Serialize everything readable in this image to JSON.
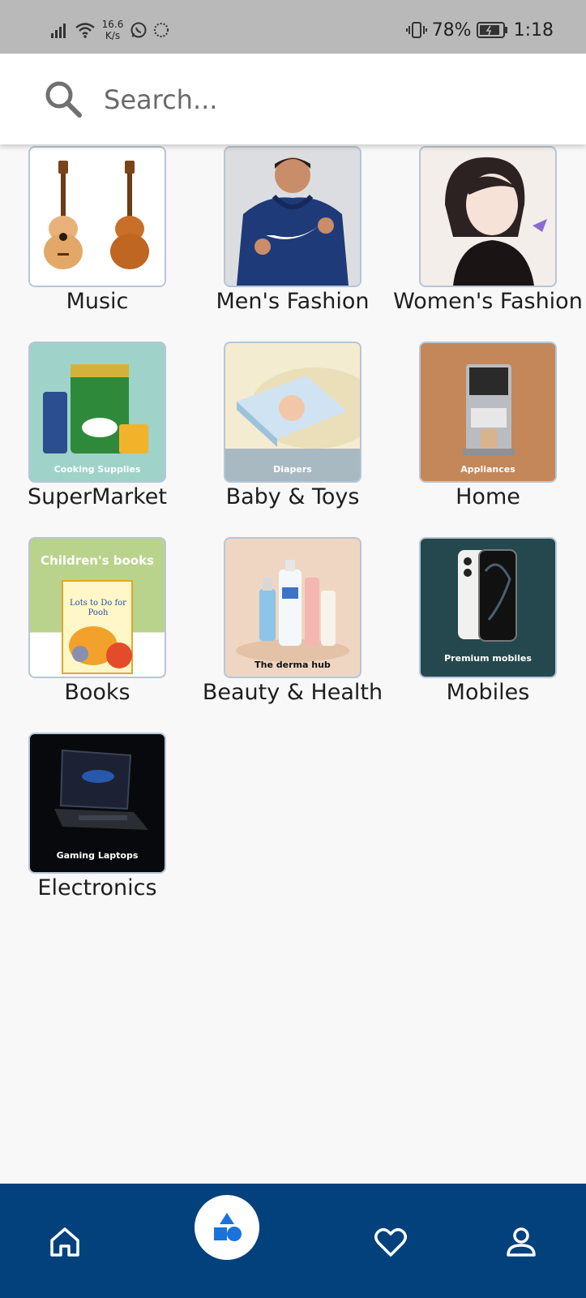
{
  "status_bar": {
    "net_speed_value": "16.6",
    "net_speed_unit": "K/s",
    "battery_percent": "78%",
    "time": "1:18"
  },
  "search": {
    "placeholder": "Search..."
  },
  "categories": [
    {
      "label": "Music",
      "icon": "guitars-image"
    },
    {
      "label": "Men's Fashion",
      "icon": "hoodie-model-image"
    },
    {
      "label": "Women's Fashion",
      "icon": "girl-illustration-image"
    },
    {
      "label": "SuperMarket",
      "icon": "groceries-image",
      "caption": "Cooking Supplies"
    },
    {
      "label": "Baby & Toys",
      "icon": "diapers-image",
      "caption": "Diapers"
    },
    {
      "label": "Home",
      "icon": "coffee-machine-image",
      "caption": "Appliances"
    },
    {
      "label": "Books",
      "icon": "book-image",
      "caption": "Children's books",
      "book_title": "Lots to Do for Pooh"
    },
    {
      "label": "Beauty & Health",
      "icon": "cosmetics-image",
      "caption": "The derma hub"
    },
    {
      "label": "Mobiles",
      "icon": "phone-image",
      "caption": "Premium mobiles"
    },
    {
      "label": "Electronics",
      "icon": "laptop-image",
      "caption": "Gaming Laptops"
    }
  ],
  "bottom_nav": {
    "items": [
      "home-icon",
      "categories-icon",
      "heart-icon",
      "profile-icon"
    ],
    "active": "categories-icon"
  },
  "colors": {
    "nav_background": "#03417d",
    "accent_blue": "#1a73d9",
    "thumb_border": "#b7c6d6"
  }
}
